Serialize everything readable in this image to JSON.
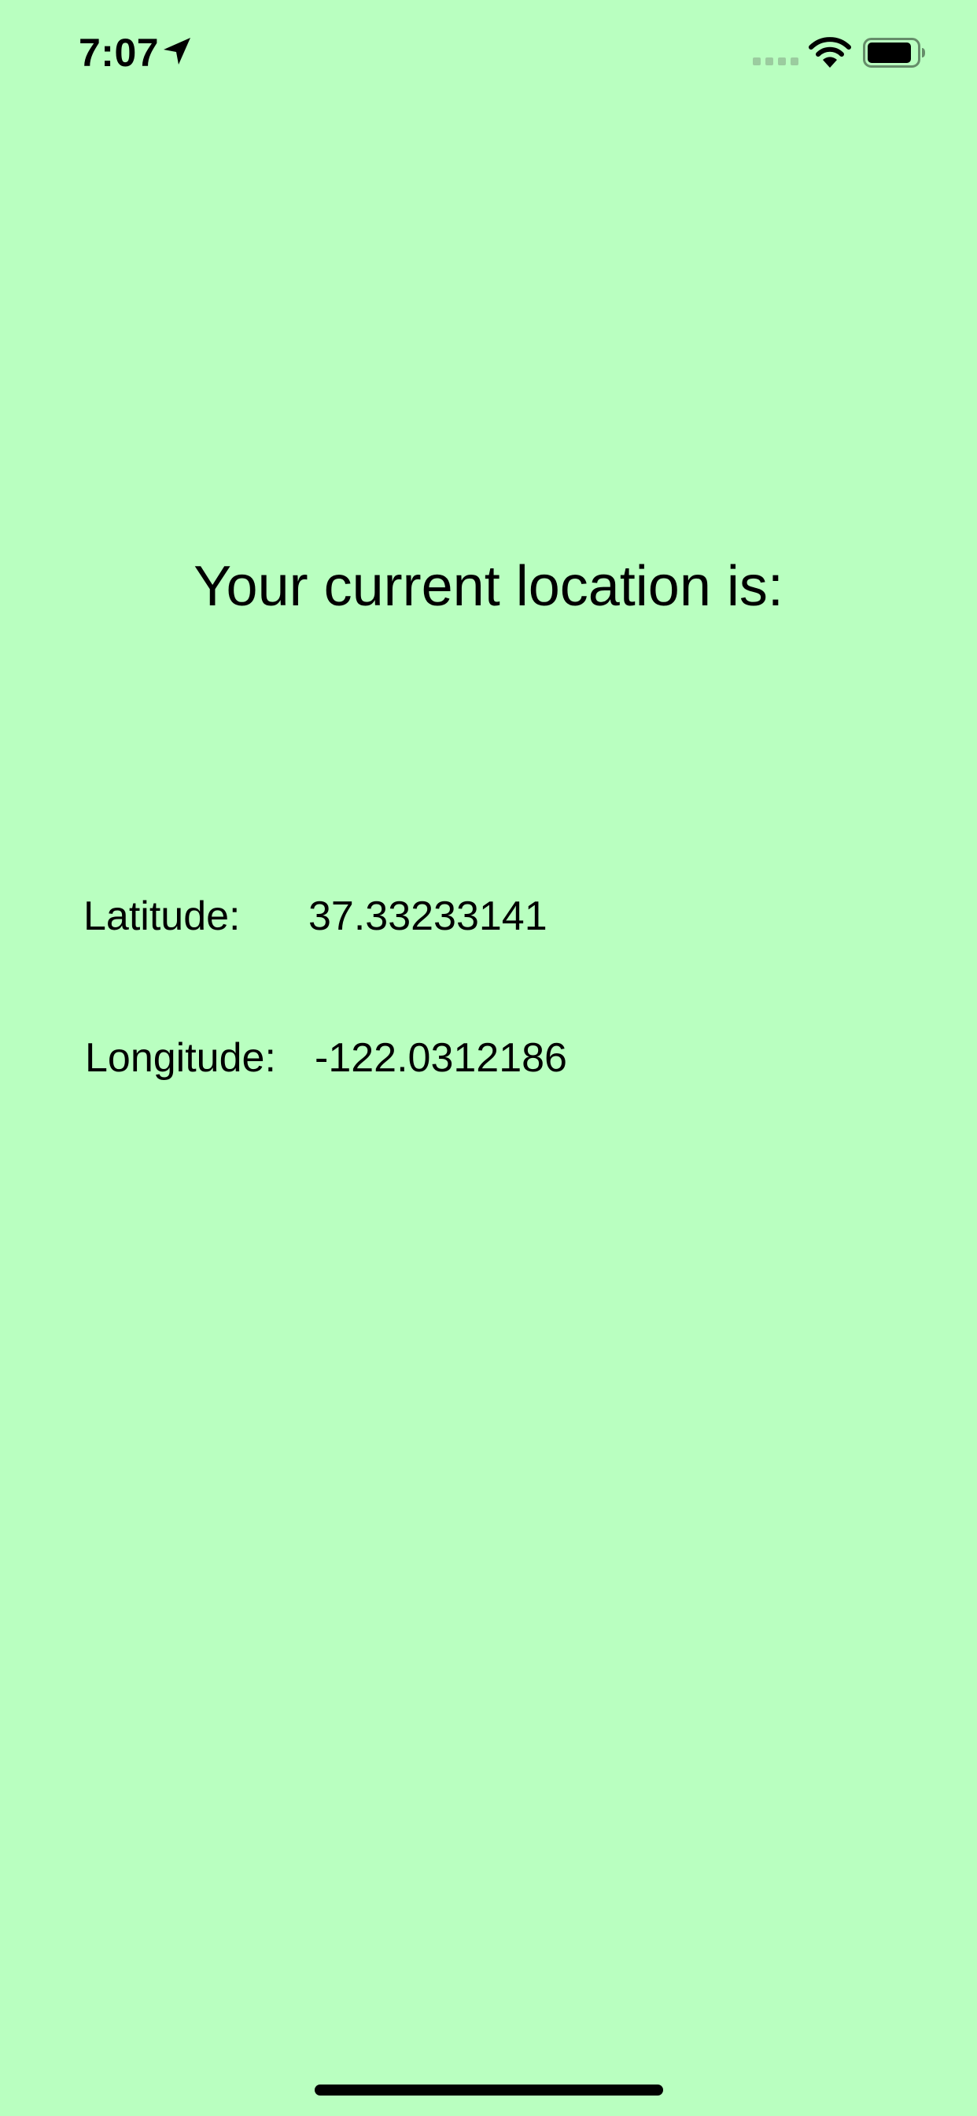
{
  "status_bar": {
    "time": "7:07",
    "icons": [
      "location-arrow-icon",
      "cellular-signal-icon",
      "wifi-icon",
      "battery-icon"
    ]
  },
  "main": {
    "heading": "Your current location is:",
    "latitude": {
      "label": "Latitude:",
      "value": "37.33233141"
    },
    "longitude": {
      "label": "Longitude:",
      "value": "-122.0312186"
    }
  },
  "colors": {
    "background": "#b9ffc0",
    "text": "#000000"
  }
}
